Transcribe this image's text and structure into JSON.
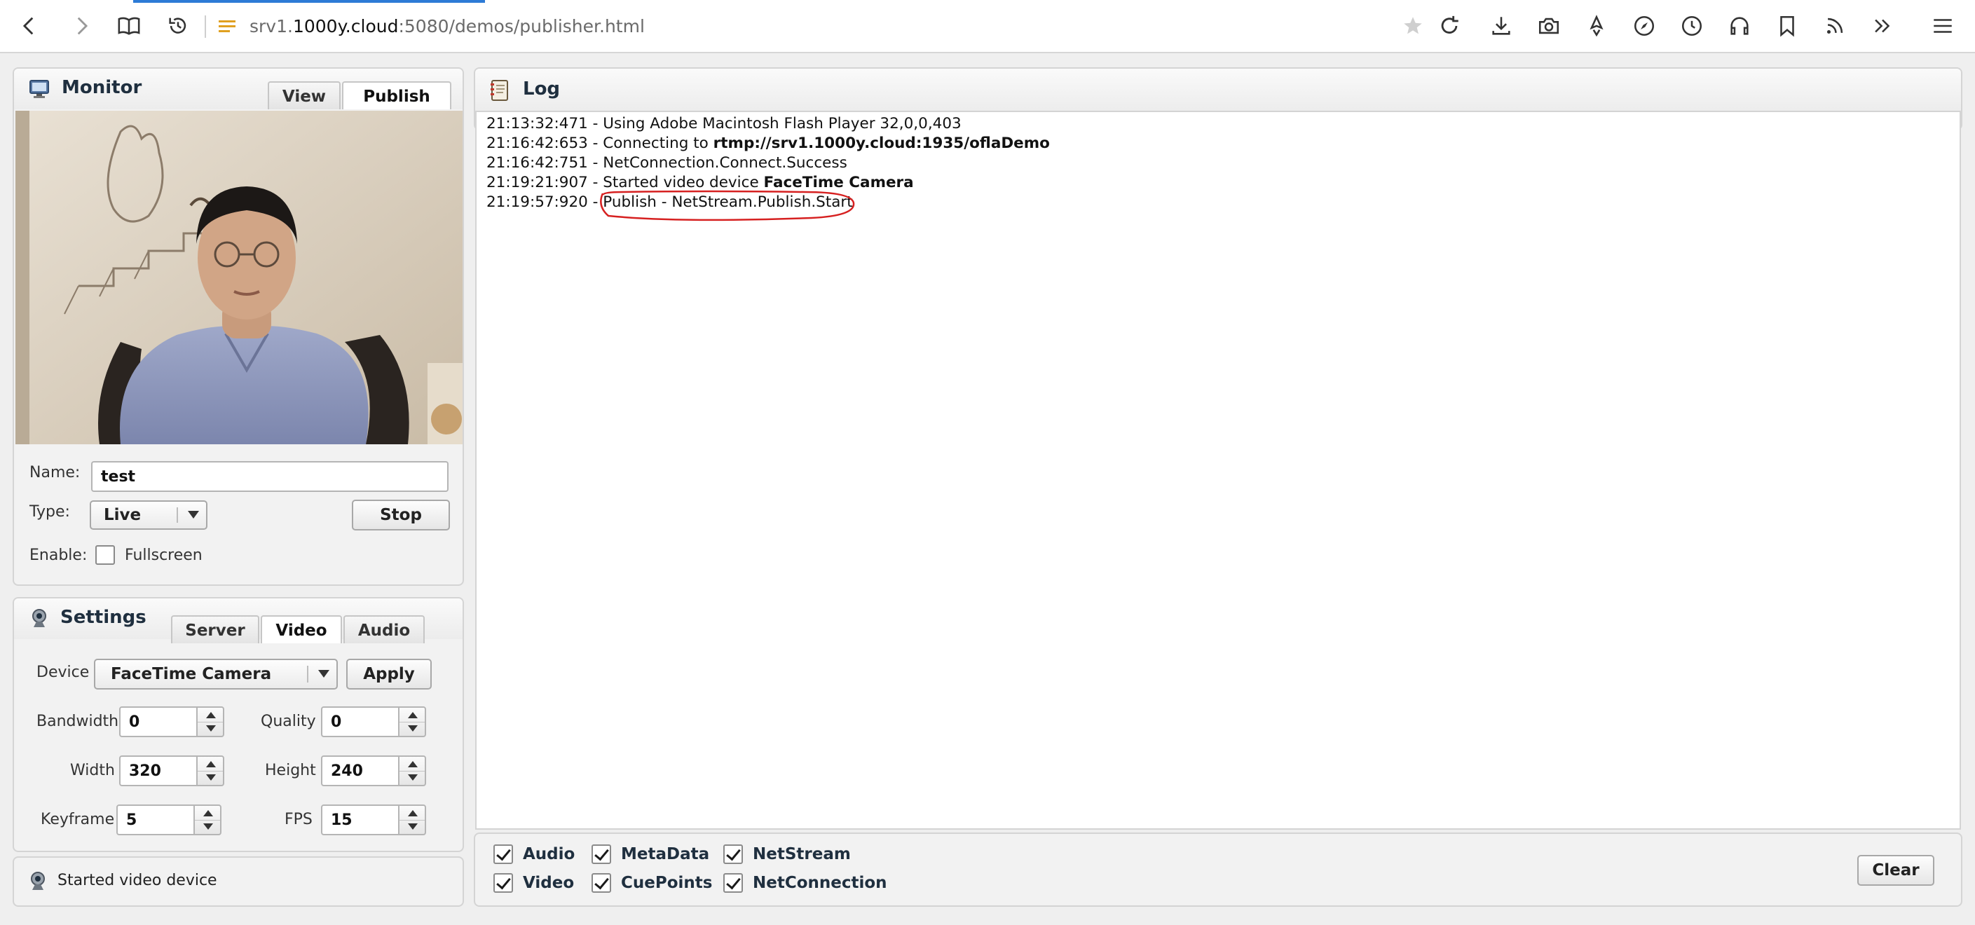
{
  "browser": {
    "url_host_prefix": "srv1.",
    "url_host_main": "1000y.cloud",
    "url_rest": ":5080/demos/publisher.html"
  },
  "monitor": {
    "title": "Monitor",
    "tabs": [
      {
        "label": "View"
      },
      {
        "label": "Publish"
      }
    ],
    "name_label": "Name:",
    "name_value": "test",
    "type_label": "Type:",
    "type_value": "Live",
    "stop_label": "Stop",
    "enable_label": "Enable:",
    "fullscreen_label": "Fullscreen"
  },
  "settings": {
    "title": "Settings",
    "tabs": [
      {
        "label": "Server"
      },
      {
        "label": "Video"
      },
      {
        "label": "Audio"
      }
    ],
    "device_label": "Device",
    "device_value": "FaceTime Camera",
    "apply_label": "Apply",
    "bandwidth_label": "Bandwidth",
    "bandwidth_value": "0",
    "quality_label": "Quality",
    "quality_value": "0",
    "width_label": "Width",
    "width_value": "320",
    "height_label": "Height",
    "height_value": "240",
    "keyframe_label": "Keyframe",
    "keyframe_value": "5",
    "fps_label": "FPS",
    "fps_value": "15"
  },
  "status": {
    "text": "Started video device"
  },
  "log": {
    "title": "Log",
    "lines": [
      {
        "prefix": "21:13:32:471 - Using Adobe Macintosh Flash Player 32,0,0,403",
        "bold": ""
      },
      {
        "prefix": "21:16:42:653 - Connecting to ",
        "bold": "rtmp://srv1.1000y.cloud:1935/oflaDemo"
      },
      {
        "prefix": "21:16:42:751 - NetConnection.Connect.Success",
        "bold": ""
      },
      {
        "prefix": "21:19:21:907 - Started video device ",
        "bold": "FaceTime Camera"
      },
      {
        "prefix": "21:19:57:920 - Publish - NetStream.Publish.Start",
        "bold": ""
      }
    ],
    "filters": {
      "audio": "Audio",
      "metadata": "MetaData",
      "netstream": "NetStream",
      "video": "Video",
      "cuepoints": "CuePoints",
      "netconnection": "NetConnection"
    },
    "clear_label": "Clear"
  },
  "colors": {
    "annotation": "#d62020",
    "accent": "#2d7bd6"
  }
}
